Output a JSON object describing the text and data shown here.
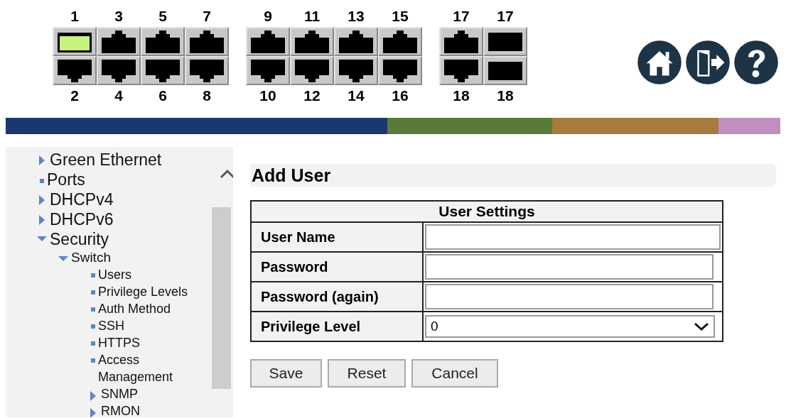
{
  "port_groups": [
    {
      "top": [
        {
          "label": "1",
          "kind": "rj45",
          "link": true
        },
        {
          "label": "3",
          "kind": "rj45",
          "link": false
        },
        {
          "label": "5",
          "kind": "rj45",
          "link": false
        },
        {
          "label": "7",
          "kind": "rj45",
          "link": false
        }
      ],
      "bottom": [
        {
          "label": "2",
          "kind": "rj45",
          "link": false
        },
        {
          "label": "4",
          "kind": "rj45",
          "link": false
        },
        {
          "label": "6",
          "kind": "rj45",
          "link": false
        },
        {
          "label": "8",
          "kind": "rj45",
          "link": false
        }
      ]
    },
    {
      "top": [
        {
          "label": "9",
          "kind": "rj45",
          "link": false
        },
        {
          "label": "11",
          "kind": "rj45",
          "link": false
        },
        {
          "label": "13",
          "kind": "rj45",
          "link": false
        },
        {
          "label": "15",
          "kind": "rj45",
          "link": false
        }
      ],
      "bottom": [
        {
          "label": "10",
          "kind": "rj45",
          "link": false
        },
        {
          "label": "12",
          "kind": "rj45",
          "link": false
        },
        {
          "label": "14",
          "kind": "rj45",
          "link": false
        },
        {
          "label": "16",
          "kind": "rj45",
          "link": false
        }
      ]
    },
    {
      "top": [
        {
          "label": "17",
          "kind": "rj45",
          "link": false
        },
        {
          "label": "17",
          "kind": "sfp",
          "link": false
        }
      ],
      "bottom": [
        {
          "label": "18",
          "kind": "rj45",
          "link": false
        },
        {
          "label": "18",
          "kind": "sfp",
          "link": false
        }
      ]
    }
  ],
  "toolbar": [
    {
      "kind": "home"
    },
    {
      "kind": "logout"
    },
    {
      "kind": "help"
    }
  ],
  "color_bar": [
    {
      "color": "#1b3770"
    },
    {
      "color": "#5b7a3a"
    },
    {
      "color": "#a57b3e"
    },
    {
      "color": "#c08fbe"
    }
  ],
  "sidebar": {
    "items": [
      {
        "label": "Green Ethernet",
        "kind": "folder",
        "expanded": false
      },
      {
        "label": "Ports",
        "kind": "page"
      },
      {
        "label": "DHCPv4",
        "kind": "folder",
        "expanded": false
      },
      {
        "label": "DHCPv6",
        "kind": "folder",
        "expanded": false
      },
      {
        "label": "Security",
        "kind": "folder",
        "expanded": true,
        "children": [
          {
            "label": "Switch",
            "kind": "folder",
            "expanded": true,
            "children": [
              {
                "label": "Users",
                "kind": "page"
              },
              {
                "label": "Privilege Levels",
                "kind": "page"
              },
              {
                "label": "Auth Method",
                "kind": "page"
              },
              {
                "label": "SSH",
                "kind": "page"
              },
              {
                "label": "HTTPS",
                "kind": "page"
              },
              {
                "label": "Access Management",
                "kind": "page"
              },
              {
                "label": "SNMP",
                "kind": "folder",
                "expanded": false
              },
              {
                "label": "RMON",
                "kind": "folder",
                "expanded": false
              }
            ]
          }
        ]
      }
    ]
  },
  "page_title": "Add User",
  "settings_table": {
    "title": "User Settings",
    "rows": [
      {
        "label": "User Name",
        "kind": "text"
      },
      {
        "label": "Password",
        "kind": "password"
      },
      {
        "label": "Password (again)",
        "kind": "password"
      },
      {
        "label": "Privilege Level",
        "kind": "select",
        "value": "0"
      }
    ]
  },
  "buttons": [
    "Save",
    "Reset",
    "Cancel"
  ]
}
